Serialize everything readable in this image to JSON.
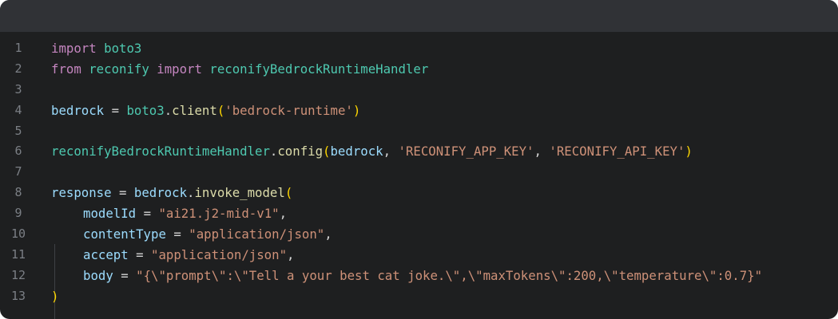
{
  "window": {
    "titlebar_color": "#303236",
    "background_color": "#1e1f20"
  },
  "code": {
    "lines": [
      {
        "number": "1",
        "indent": false,
        "tokens": [
          {
            "t": "kw",
            "v": "import"
          },
          {
            "t": "pun",
            "v": " "
          },
          {
            "t": "mod",
            "v": "boto3"
          }
        ]
      },
      {
        "number": "2",
        "indent": false,
        "tokens": [
          {
            "t": "kw",
            "v": "from"
          },
          {
            "t": "pun",
            "v": " "
          },
          {
            "t": "mod",
            "v": "reconify"
          },
          {
            "t": "pun",
            "v": " "
          },
          {
            "t": "kw",
            "v": "import"
          },
          {
            "t": "pun",
            "v": " "
          },
          {
            "t": "mod",
            "v": "reconifyBedrockRuntimeHandler"
          }
        ]
      },
      {
        "number": "3",
        "indent": false,
        "tokens": []
      },
      {
        "number": "4",
        "indent": false,
        "tokens": [
          {
            "t": "var",
            "v": "bedrock"
          },
          {
            "t": "pun",
            "v": " = "
          },
          {
            "t": "mod",
            "v": "boto3"
          },
          {
            "t": "pun",
            "v": "."
          },
          {
            "t": "fn",
            "v": "client"
          },
          {
            "t": "br",
            "v": "("
          },
          {
            "t": "str",
            "v": "'bedrock-runtime'"
          },
          {
            "t": "br",
            "v": ")"
          }
        ]
      },
      {
        "number": "5",
        "indent": false,
        "tokens": []
      },
      {
        "number": "6",
        "indent": false,
        "tokens": [
          {
            "t": "mod",
            "v": "reconifyBedrockRuntimeHandler"
          },
          {
            "t": "pun",
            "v": "."
          },
          {
            "t": "fn",
            "v": "config"
          },
          {
            "t": "br",
            "v": "("
          },
          {
            "t": "var",
            "v": "bedrock"
          },
          {
            "t": "pun",
            "v": ", "
          },
          {
            "t": "str",
            "v": "'RECONIFY_APP_KEY'"
          },
          {
            "t": "pun",
            "v": ", "
          },
          {
            "t": "str",
            "v": "'RECONIFY_API_KEY'"
          },
          {
            "t": "br",
            "v": ")"
          }
        ]
      },
      {
        "number": "7",
        "indent": false,
        "tokens": []
      },
      {
        "number": "8",
        "indent": false,
        "tokens": [
          {
            "t": "var",
            "v": "response"
          },
          {
            "t": "pun",
            "v": " = "
          },
          {
            "t": "var",
            "v": "bedrock"
          },
          {
            "t": "pun",
            "v": "."
          },
          {
            "t": "fn",
            "v": "invoke_model"
          },
          {
            "t": "br",
            "v": "("
          }
        ]
      },
      {
        "number": "9",
        "indent": true,
        "tokens": [
          {
            "t": "var",
            "v": "modelId"
          },
          {
            "t": "pun",
            "v": " = "
          },
          {
            "t": "str",
            "v": "\"ai21.j2-mid-v1\""
          },
          {
            "t": "pun",
            "v": ","
          }
        ]
      },
      {
        "number": "10",
        "indent": true,
        "tokens": [
          {
            "t": "var",
            "v": "contentType"
          },
          {
            "t": "pun",
            "v": " = "
          },
          {
            "t": "str",
            "v": "\"application/json\""
          },
          {
            "t": "pun",
            "v": ","
          }
        ]
      },
      {
        "number": "11",
        "indent": true,
        "tokens": [
          {
            "t": "var",
            "v": "accept"
          },
          {
            "t": "pun",
            "v": " = "
          },
          {
            "t": "str",
            "v": "\"application/json\""
          },
          {
            "t": "pun",
            "v": ","
          }
        ]
      },
      {
        "number": "12",
        "indent": true,
        "tokens": [
          {
            "t": "var",
            "v": "body"
          },
          {
            "t": "pun",
            "v": " = "
          },
          {
            "t": "str",
            "v": "\"{\\\"prompt\\\":\\\"Tell a your best cat joke.\\\",\\\"maxTokens\\\":200,\\\"temperature\\\":0.7}\""
          }
        ]
      },
      {
        "number": "13",
        "indent": false,
        "tokens": [
          {
            "t": "br",
            "v": ")"
          }
        ]
      }
    ]
  }
}
